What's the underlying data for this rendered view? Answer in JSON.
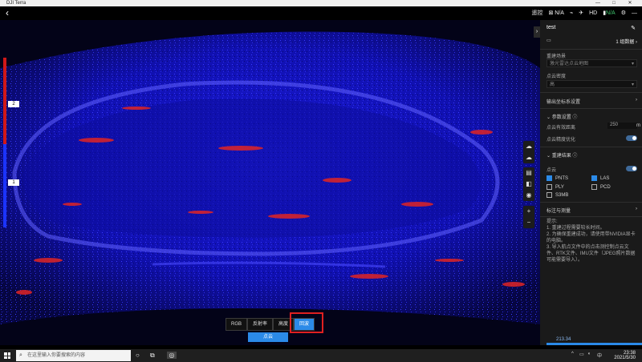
{
  "titlebar": {
    "title": "DJI Terra",
    "min": "—",
    "max": "□",
    "close": "✕"
  },
  "topbar": {
    "back": "‹",
    "status_left": "遥控",
    "status_items": [
      {
        "icon": "rtk-icon",
        "glyph": "⊠",
        "label": "N/A"
      },
      {
        "icon": "signal-icon",
        "glyph": "⌁",
        "label": ""
      },
      {
        "icon": "drone-icon",
        "glyph": "✈",
        "label": ""
      },
      {
        "icon": "hd-icon",
        "glyph": "",
        "label": "HD"
      },
      {
        "icon": "battery-icon",
        "glyph": "▮",
        "label": "N/A"
      }
    ],
    "gear": "⚙",
    "minimize": "—"
  },
  "viewer": {
    "slider_markers": [
      "2",
      "1"
    ],
    "right_tools": [
      "☁",
      "☁",
      "▤",
      "◧",
      "◉",
      "+",
      "−"
    ],
    "tabs": [
      {
        "label": "RGB",
        "active": false
      },
      {
        "label": "反射率",
        "active": false
      },
      {
        "label": "高度",
        "active": false
      },
      {
        "label": "回波",
        "active": true
      }
    ],
    "pointcloud_button": "点云"
  },
  "panel": {
    "title": "test",
    "models_count": "1 组数据",
    "scene_label": "重建场景",
    "scene_value": "激光雷达点云地图",
    "density_label": "点云密度",
    "density_value": "高",
    "coord_label": "输出坐标系设置",
    "params_label": "参数设置",
    "effective_distance_label": "点云有效距离",
    "effective_distance_value": "250",
    "effective_distance_unit": "m",
    "accuracy_label": "点云精度优化",
    "results_label": "重建结果",
    "pointcloud_label": "点云",
    "formats": [
      {
        "label": "PNTS",
        "checked": true
      },
      {
        "label": "LAS",
        "checked": true
      },
      {
        "label": "PLY",
        "checked": false
      },
      {
        "label": "PCD",
        "checked": false
      },
      {
        "label": "S3MB",
        "checked": false
      }
    ],
    "calib_label": "标注与测量",
    "hint_title": "提示:",
    "hints": [
      "1. 重建过程需要较长时间。",
      "2. 为确保重建成功，请使用带NVIDIA显卡的电脑。",
      "3. 导入航点文件中的点击测控制点云文件、RTK文件、IMU文件（JPEG照片数据可能需要导入）。"
    ],
    "progress_label": "213.34"
  },
  "taskbar": {
    "search_placeholder": "在这里输入你要搜索的内容",
    "time": "23:38",
    "date": "2021/5/30",
    "ime": "中"
  }
}
